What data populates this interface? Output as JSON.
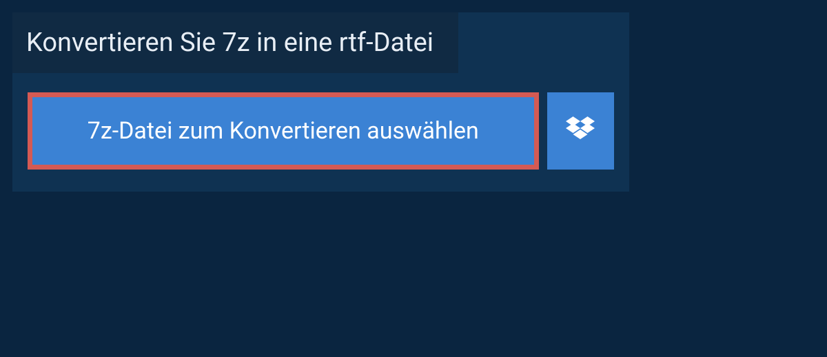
{
  "title": "Konvertieren Sie 7z in eine rtf-Datei",
  "buttons": {
    "select_file_label": "7z-Datei zum Konvertieren auswählen"
  },
  "icons": {
    "dropbox": "dropbox-icon"
  },
  "colors": {
    "page_bg": "#0a2540",
    "panel_bg": "#0f3252",
    "title_bar_bg": "#102a43",
    "button_bg": "#3b82d4",
    "highlight_border": "#d45a54",
    "text_light": "#e8eef5",
    "text_white": "#ffffff"
  }
}
